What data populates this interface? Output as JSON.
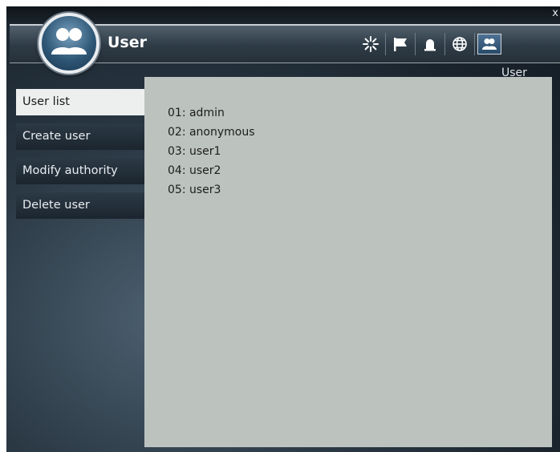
{
  "window": {
    "close_glyph": "x"
  },
  "header": {
    "title": "User",
    "logo_icon": "users-icon",
    "toolbar": [
      {
        "name": "loading-spinner-icon"
      },
      {
        "name": "flag-icon"
      },
      {
        "name": "alarm-bell-icon"
      },
      {
        "name": "globe-icon"
      },
      {
        "name": "users-icon",
        "active": true
      }
    ],
    "active_label": "User"
  },
  "sidebar": {
    "items": [
      {
        "label": "User list",
        "active": true
      },
      {
        "label": "Create user"
      },
      {
        "label": "Modify authority"
      },
      {
        "label": "Delete user"
      }
    ]
  },
  "main": {
    "users": [
      "01: admin",
      "02: anonymous",
      "03: user1",
      "04: user2",
      "05: user3"
    ]
  },
  "colors": {
    "panel_bg": "#bcc3bf",
    "active_tab_bg": "#ecefee",
    "accent_blue": "#2f5776"
  }
}
